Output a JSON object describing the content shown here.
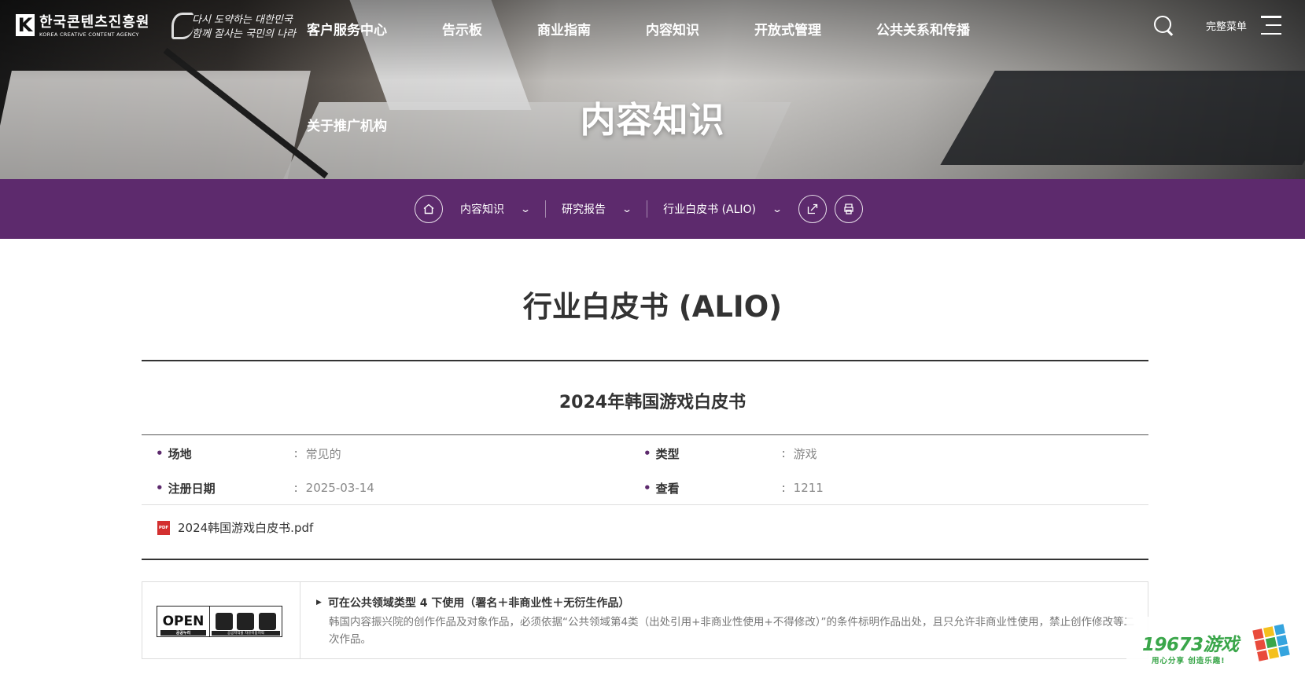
{
  "header": {
    "logo_kr": "한국콘텐츠진흥원",
    "logo_en": "KOREA CREATIVE CONTENT AGENCY",
    "slogan_line1": "다시 도약하는 대한민국",
    "slogan_line2": "함께 잘사는 국민의 나라",
    "nav": [
      "客户服务中心",
      "告示板",
      "商业指南",
      "内容知识",
      "开放式管理",
      "公共关系和传播"
    ],
    "nav_about": "关于推广机构",
    "full_menu_label": "完整菜单",
    "hero_title": "内容知识"
  },
  "location": {
    "crumbs": [
      "内容知识",
      "研究报告",
      "行业白皮书 (ALIO)"
    ],
    "home_icon": "home-icon",
    "share_icon": "share-icon",
    "print_icon": "print-icon"
  },
  "content": {
    "page_title": "行业白皮书 (ALIO)",
    "post_title": "2024年韩国游戏白皮书",
    "info": {
      "place_label": "场地",
      "place_value": "常见的",
      "type_label": "类型",
      "type_value": "游戏",
      "date_label": "注册日期",
      "date_value": "2025-03-14",
      "views_label": "查看",
      "views_value": "1211"
    },
    "attachment": "2024韩国游戏白皮书.pdf"
  },
  "license": {
    "badge_open": "OPEN",
    "badge_sub": "공공누리",
    "badge_icons_sub": "공공저작물 자유이용허락",
    "heading": "可在公共领域类型 4 下使用（署名＋非商业性＋无衍生作品）",
    "body": "韩国内容振兴院的创作作品及对象作品，必须依据“公共领域第4类（出处引用+非商业性使用+不得修改）”的条件标明作品出处，且只允许非商业性使用，禁止创作修改等二次作品。"
  },
  "watermark": {
    "text": "19673游戏",
    "sub": "用心分享 创造乐趣!"
  },
  "colors": {
    "location_bar": "#5d2a6d",
    "pdf": "#d32f2f",
    "watermark": "#3aa64a"
  }
}
